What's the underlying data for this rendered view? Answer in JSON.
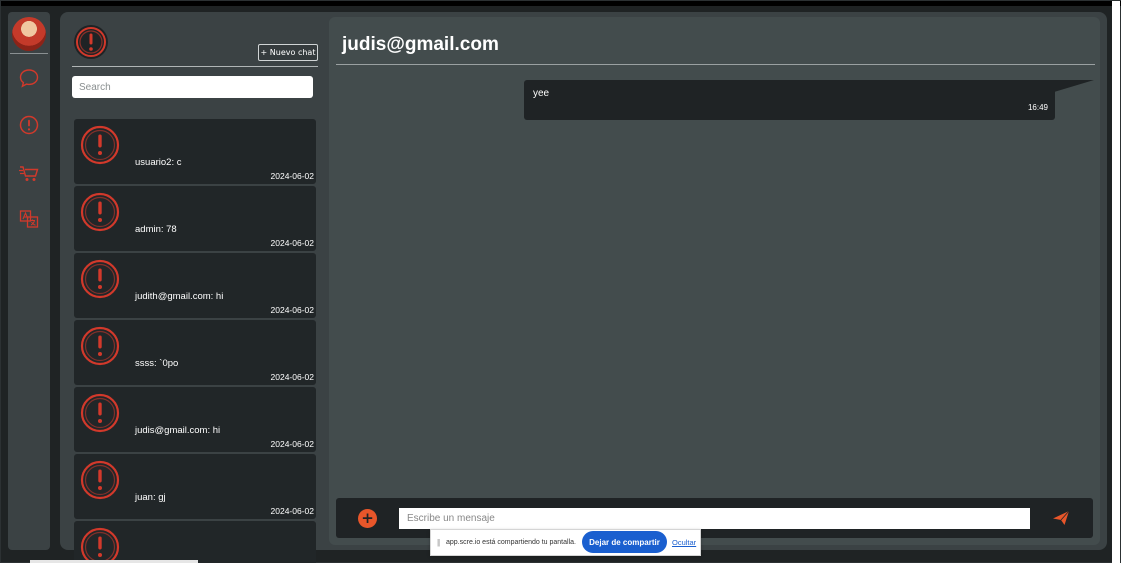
{
  "sidebar": {
    "avatar_alt": "user avatar",
    "icons": [
      "chat-bubble-icon",
      "alert-icon",
      "cart-icon",
      "translate-icon"
    ]
  },
  "chat_list": {
    "new_chat_label": "+ Nuevo chat",
    "search_placeholder": "Search",
    "items": [
      {
        "preview": "usuario2: c",
        "date": "2024-06-02"
      },
      {
        "preview": "admin: 78",
        "date": "2024-06-02"
      },
      {
        "preview": "judith@gmail.com: hi",
        "date": "2024-06-02"
      },
      {
        "preview": "ssss: `0po",
        "date": "2024-06-02"
      },
      {
        "preview": "judis@gmail.com: hi",
        "date": "2024-06-02"
      },
      {
        "preview": "juan: gj",
        "date": "2024-06-02"
      },
      {
        "preview": "",
        "date": ""
      }
    ]
  },
  "conversation": {
    "title": "judis@gmail.com",
    "messages": [
      {
        "text": "yee",
        "time": "16:49"
      }
    ],
    "composer_placeholder": "Escribe un mensaje"
  },
  "share_banner": {
    "text": "app.scre.io está compartiendo tu pantalla.",
    "stop_label": "Dejar de compartir",
    "hide_label": "Ocultar"
  },
  "colors": {
    "accent": "#e8562a",
    "alert_red": "#d2392b",
    "panel": "#3b4244",
    "card": "#212628",
    "link_blue": "#1a5fcf"
  }
}
